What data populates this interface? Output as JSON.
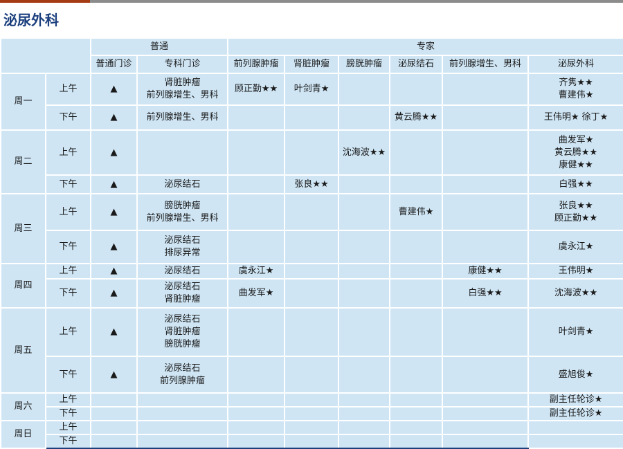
{
  "title": "泌尿外科",
  "colors": {
    "bar_accent": "#a63c14",
    "bar_rest": "#8c8c8c",
    "title": "#1b3f7d",
    "cell_bg": "#cfe5f4",
    "bottom_line": "#1f3f7a"
  },
  "header": {
    "groups": [
      "普通",
      "专家"
    ],
    "columns": [
      "普通门诊",
      "专科门诊",
      "前列腺肿瘤",
      "肾脏肿瘤",
      "膀胱肿瘤",
      "泌尿结石",
      "前列腺增生、男科",
      "泌尿外科"
    ]
  },
  "days": [
    {
      "day": "周一",
      "periods": [
        {
          "period": "上午",
          "cells": [
            [
              "▲"
            ],
            [
              "肾脏肿瘤",
              "前列腺增生、男科"
            ],
            [
              "顾正勤★★"
            ],
            [
              "叶剑青★"
            ],
            [],
            [],
            [],
            [
              "齐隽★★",
              "曹建伟★"
            ]
          ]
        },
        {
          "period": "下午",
          "cells": [
            [
              "▲"
            ],
            [
              "前列腺增生、男科"
            ],
            [],
            [],
            [],
            [
              "黄云腾★★"
            ],
            [],
            [
              "王伟明★ 徐丁★"
            ]
          ]
        }
      ]
    },
    {
      "day": "周二",
      "periods": [
        {
          "period": "上午",
          "cells": [
            [
              "▲"
            ],
            [],
            [],
            [],
            [
              "沈海波★★"
            ],
            [],
            [],
            [
              "曲发军★",
              "黄云腾★★",
              "康健★★"
            ]
          ]
        },
        {
          "period": "下午",
          "cells": [
            [
              "▲"
            ],
            [
              "泌尿结石"
            ],
            [],
            [
              "张良★★"
            ],
            [],
            [],
            [],
            [
              "白强★★"
            ]
          ]
        }
      ]
    },
    {
      "day": "周三",
      "periods": [
        {
          "period": "上午",
          "cells": [
            [
              "▲"
            ],
            [
              "膀胱肿瘤",
              "前列腺增生、男科"
            ],
            [],
            [],
            [],
            [
              "曹建伟★"
            ],
            [],
            [
              "张良★★",
              "顾正勤★★"
            ]
          ]
        },
        {
          "period": "下午",
          "cells": [
            [
              "▲"
            ],
            [
              "泌尿结石",
              "排尿异常"
            ],
            [],
            [],
            [],
            [],
            [],
            [
              "虞永江★"
            ]
          ]
        }
      ]
    },
    {
      "day": "周四",
      "periods": [
        {
          "period": "上午",
          "cells": [
            [
              "▲"
            ],
            [
              "泌尿结石"
            ],
            [
              "虞永江★"
            ],
            [],
            [],
            [],
            [
              "康健★★"
            ],
            [
              "王伟明★"
            ]
          ]
        },
        {
          "period": "下午",
          "cells": [
            [
              "▲"
            ],
            [
              "泌尿结石",
              "肾脏肿瘤"
            ],
            [
              "曲发军★"
            ],
            [],
            [],
            [],
            [
              "白强★★"
            ],
            [
              "沈海波★★"
            ]
          ]
        }
      ]
    },
    {
      "day": "周五",
      "periods": [
        {
          "period": "上午",
          "cells": [
            [
              "▲"
            ],
            [
              "泌尿结石",
              "肾脏肿瘤",
              "膀胱肿瘤"
            ],
            [],
            [],
            [],
            [],
            [],
            [
              "叶剑青★"
            ]
          ]
        },
        {
          "period": "下午",
          "cells": [
            [
              "▲"
            ],
            [
              "泌尿结石",
              "前列腺肿瘤"
            ],
            [],
            [],
            [],
            [],
            [],
            [
              "盛旭俊★"
            ]
          ]
        }
      ]
    },
    {
      "day": "周六",
      "periods": [
        {
          "period": "上午",
          "cells": [
            [],
            [],
            [],
            [],
            [],
            [],
            [],
            [
              "副主任轮诊★"
            ]
          ]
        },
        {
          "period": "下午",
          "cells": [
            [],
            [],
            [],
            [],
            [],
            [],
            [],
            [
              "副主任轮诊★"
            ]
          ]
        }
      ]
    },
    {
      "day": "周日",
      "periods": [
        {
          "period": "上午",
          "cells": [
            [],
            [],
            [],
            [],
            [],
            [],
            [],
            []
          ]
        },
        {
          "period": "下午",
          "cells": [
            [],
            [],
            [],
            [],
            [],
            [],
            [],
            []
          ]
        }
      ]
    }
  ]
}
